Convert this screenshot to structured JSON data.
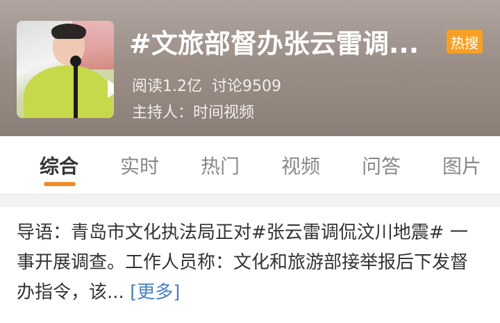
{
  "topic": {
    "title": "#文旅部督办张云雷调...",
    "hot_badge": "热搜",
    "read_label": "阅读1.2亿",
    "discuss_label": "讨论9509",
    "host": "主持人：时间视频"
  },
  "tabs": [
    {
      "label": "综合",
      "active": true
    },
    {
      "label": "实时",
      "active": false
    },
    {
      "label": "热门",
      "active": false
    },
    {
      "label": "视频",
      "active": false
    },
    {
      "label": "问答",
      "active": false
    },
    {
      "label": "图片",
      "active": false
    }
  ],
  "intro": {
    "text": "导语：青岛市文化执法局正对#张云雷调侃汶川地震# 一事开展调查。工作人员称：文化和旅游部接举报后下发督办指令，该...",
    "more": "[更多]"
  },
  "colors": {
    "accent": "#f08c2a",
    "badge": "#f6a125",
    "link": "#4a7fc1"
  }
}
